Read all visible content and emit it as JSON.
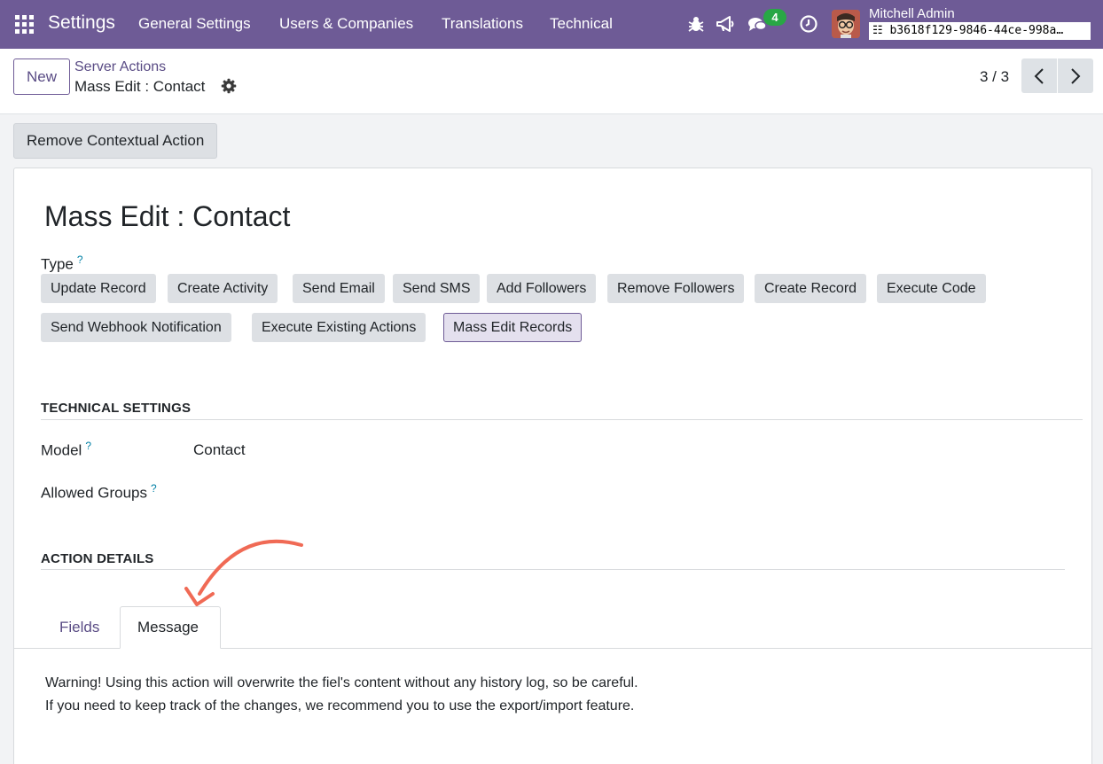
{
  "navbar": {
    "app_name": "Settings",
    "menu": [
      "General Settings",
      "Users & Companies",
      "Translations",
      "Technical"
    ],
    "chat_count": "4",
    "user_name": "Mitchell Admin",
    "database": "b3618f129-9846-44ce-998a…"
  },
  "control": {
    "new_label": "New",
    "breadcrumb_parent": "Server Actions",
    "breadcrumb_current": "Mass Edit : Contact",
    "pager": "3 / 3"
  },
  "actions": {
    "remove_contextual": "Remove Contextual Action"
  },
  "form": {
    "title": "Mass Edit : Contact",
    "type_label": "Type",
    "help_mark": "?",
    "types": [
      "Update Record",
      "Create Activity",
      "Send Email",
      "Send SMS",
      "Add Followers",
      "Remove Followers",
      "Create Record",
      "Execute Code",
      "Send Webhook Notification",
      "Execute Existing Actions",
      "Mass Edit Records"
    ],
    "selected_type": "Mass Edit Records",
    "technical_settings": "TECHNICAL SETTINGS",
    "model_label": "Model",
    "model_value": "Contact",
    "allowed_groups_label": "Allowed Groups",
    "action_details": "ACTION DETAILS",
    "tabs": [
      "Fields",
      "Message"
    ],
    "active_tab": "Message",
    "message_lines": [
      "Warning! Using this action will overwrite the fiel's content without any history log, so be careful.",
      "If you need to keep track of the changes, we recommend you to use the export/import feature."
    ]
  },
  "colors": {
    "navbar": "#6e5b96",
    "link": "#5a4c85",
    "help": "#0180a5",
    "badge": "#28a745",
    "annotation_arrow": "#f06a55"
  }
}
